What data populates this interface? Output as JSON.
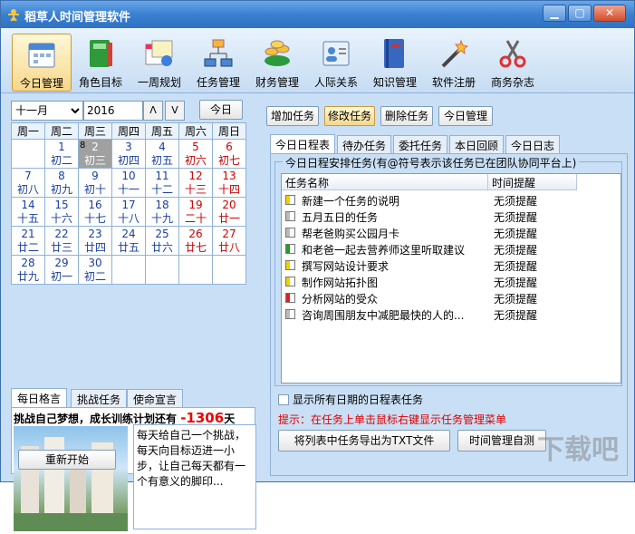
{
  "window": {
    "title": "稻草人时间管理软件"
  },
  "toolbar": {
    "items": [
      {
        "label": "今日管理",
        "icon": "calendar-icon",
        "active": true
      },
      {
        "label": "角色目标",
        "icon": "book-icon"
      },
      {
        "label": "一周规划",
        "icon": "week-plan-icon"
      },
      {
        "label": "任务管理",
        "icon": "task-tree-icon"
      },
      {
        "label": "财务管理",
        "icon": "coins-icon"
      },
      {
        "label": "人际关系",
        "icon": "contacts-icon"
      },
      {
        "label": "知识管理",
        "icon": "knowledge-book-icon"
      },
      {
        "label": "软件注册",
        "icon": "magic-wand-icon"
      },
      {
        "label": "商务杂志",
        "icon": "scissors-icon"
      }
    ]
  },
  "calendar": {
    "month": "十一月",
    "year": "2016",
    "up": "ᐱ",
    "down": "ᐯ",
    "today_label": "今日",
    "weekdays": [
      "周一",
      "周二",
      "周三",
      "周四",
      "周五",
      "周六",
      "周日"
    ],
    "weeks": [
      [
        null,
        {
          "d": "1",
          "l": "初二"
        },
        {
          "d": "2",
          "l": "初三",
          "sel": true,
          "badge": "8"
        },
        {
          "d": "3",
          "l": "初四"
        },
        {
          "d": "4",
          "l": "初五"
        },
        {
          "d": "5",
          "l": "初六"
        },
        {
          "d": "6",
          "l": "初七"
        }
      ],
      [
        {
          "d": "7",
          "l": "初八"
        },
        {
          "d": "8",
          "l": "初九"
        },
        {
          "d": "9",
          "l": "初十"
        },
        {
          "d": "10",
          "l": "十一"
        },
        {
          "d": "11",
          "l": "十二"
        },
        {
          "d": "12",
          "l": "十三"
        },
        {
          "d": "13",
          "l": "十四"
        }
      ],
      [
        {
          "d": "14",
          "l": "十五"
        },
        {
          "d": "15",
          "l": "十六"
        },
        {
          "d": "16",
          "l": "十七"
        },
        {
          "d": "17",
          "l": "十八"
        },
        {
          "d": "18",
          "l": "十九"
        },
        {
          "d": "19",
          "l": "二十"
        },
        {
          "d": "20",
          "l": "廿一"
        }
      ],
      [
        {
          "d": "21",
          "l": "廿二"
        },
        {
          "d": "22",
          "l": "廿三"
        },
        {
          "d": "23",
          "l": "廿四"
        },
        {
          "d": "24",
          "l": "廿五"
        },
        {
          "d": "25",
          "l": "廿六"
        },
        {
          "d": "26",
          "l": "廿七"
        },
        {
          "d": "27",
          "l": "廿八"
        }
      ],
      [
        {
          "d": "28",
          "l": "廿九"
        },
        {
          "d": "29",
          "l": "初一"
        },
        {
          "d": "30",
          "l": "初二"
        },
        null,
        null,
        null,
        null
      ]
    ]
  },
  "motto": {
    "tabs": [
      "每日格言",
      "挑战任务",
      "使命宣言"
    ],
    "headline": "挑战自己梦想，成长训练计划还有",
    "days_value": "-1306",
    "days_unit": "天",
    "quote": "每天给自己一个挑战，每天向目标迈进一小步，让自己每天都有一个有意义的脚印...",
    "restart_label": "重新开始"
  },
  "actions": {
    "add": "增加任务",
    "edit": "修改任务",
    "delete": "删除任务",
    "today": "今日管理"
  },
  "tabs": [
    "今日日程表",
    "待办任务",
    "委托任务",
    "本日回顾",
    "今日日志"
  ],
  "group_label": "今日日程安排任务(有@符号表示该任务已在团队协同平台上)",
  "list": {
    "col_name": "任务名称",
    "col_remind": "时间提醒",
    "rows": [
      {
        "name": "新建一个任务的说明",
        "remind": "无须提醒",
        "color": "#f0d000"
      },
      {
        "name": "五月五日的任务",
        "remind": "无须提醒",
        "color": "#bbbbbb"
      },
      {
        "name": "帮老爸购买公园月卡",
        "remind": "无须提醒",
        "color": "#bbbbbb"
      },
      {
        "name": "和老爸一起去营养师这里听取建议",
        "remind": "无须提醒",
        "color": "#20a020"
      },
      {
        "name": "撰写网站设计要求",
        "remind": "无须提醒",
        "color": "#f0d000"
      },
      {
        "name": "制作网站拓扑图",
        "remind": "无须提醒",
        "color": "#f0d000"
      },
      {
        "name": "分析网站的受众",
        "remind": "无须提醒",
        "color": "#e02020"
      },
      {
        "name": "咨询周围朋友中减肥最快的人的...",
        "remind": "无须提醒",
        "color": "#bbbbbb"
      }
    ]
  },
  "show_all_label": "显示所有日期的日程表任务",
  "tip": "提示：在任务上单击鼠标右键显示任务管理菜单",
  "export_label": "将列表中任务导出为TXT文件",
  "selftest_label": "时间管理自测",
  "watermark": "下载吧"
}
